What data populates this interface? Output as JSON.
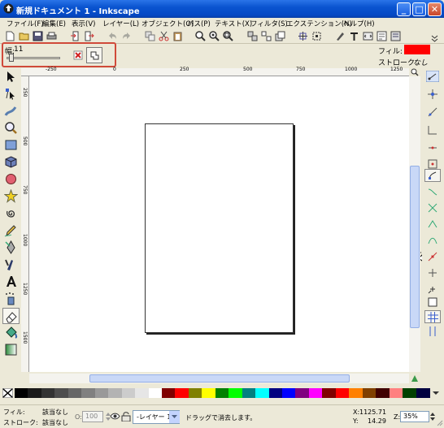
{
  "window": {
    "title": "新規ドキュメント 1 - Inkscape",
    "min": "_",
    "max": "□",
    "close": "✕"
  },
  "menu": [
    "ファイル(F)",
    "編集(E)",
    "表示(V)",
    "レイヤー(L)",
    "オブジェクト(O)",
    "パス(P)",
    "テキスト(X)",
    "フィルタ(S)",
    "エクステンション(N)",
    "ヘルプ(H)"
  ],
  "toolctl": {
    "width_label": "幅:",
    "width_value": "11"
  },
  "style_indicator": {
    "fill_label": "フィル:",
    "fill_color": "#ff0000",
    "stroke_label": "ストローク:",
    "stroke_value": "なし"
  },
  "ruler": {
    "h_ticks": [
      "-250",
      "0",
      "250",
      "500",
      "750",
      "1000",
      "1250"
    ],
    "v_ticks": [
      "250",
      "500",
      "750",
      "1000",
      "1250",
      "1500"
    ]
  },
  "palette_colors": [
    "#000000",
    "#1a1a1a",
    "#333333",
    "#4d4d4d",
    "#666666",
    "#808080",
    "#999999",
    "#b3b3b3",
    "#cccccc",
    "#e6e6e6",
    "#ffffff",
    "#800000",
    "#ff0000",
    "#808000",
    "#ffff00",
    "#008000",
    "#00ff00",
    "#008080",
    "#00ffff",
    "#000080",
    "#0000ff",
    "#800080",
    "#ff00ff",
    "#800000",
    "#ff0000",
    "#ff8000",
    "#804000",
    "#400000",
    "#ff8080",
    "#004000",
    "#000040"
  ],
  "status": {
    "fill_label": "フィル:",
    "fill_value": "該当なし",
    "stroke_label": "ストローク:",
    "stroke_value": "該当なし",
    "opacity_label": "O:",
    "opacity_value": "100",
    "layer": "-レイヤー 1",
    "message": "ドラッグで消去します。",
    "x_label": "X:",
    "x_value": "1125.71",
    "y_label": "Y:",
    "y_value": "14.29",
    "zoom_label": "Z:",
    "zoom_value": "35%"
  }
}
